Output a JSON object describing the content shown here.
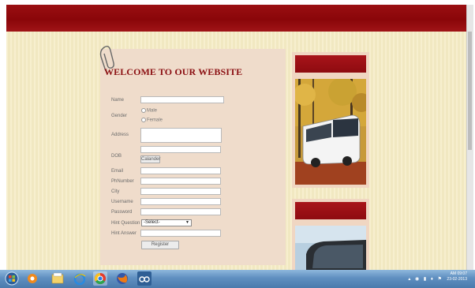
{
  "page": {
    "welcome_title": "WELCOME TO OUR WEBSITE"
  },
  "form": {
    "labels": {
      "name": "Name",
      "gender": "Gender",
      "address": "Address",
      "dob": "DOB",
      "email": "Email",
      "phnumber": "PhNumber",
      "city": "City",
      "username": "Username",
      "password": "Password",
      "hint_question": "Hint Question",
      "hint_answer": "Hint Answer"
    },
    "gender_options": [
      "Male",
      "Female"
    ],
    "calendar_button": "Calander",
    "hint_select_value": "-Select-",
    "register_button": "Register"
  },
  "taskbar": {
    "clock_time": "AM 09:07",
    "clock_date": "23-02-2013"
  },
  "colors": {
    "banner": "#8a0609",
    "page_bg": "#f5ecc4",
    "panel_bg": "#efdccb",
    "title": "#8b0f12"
  }
}
